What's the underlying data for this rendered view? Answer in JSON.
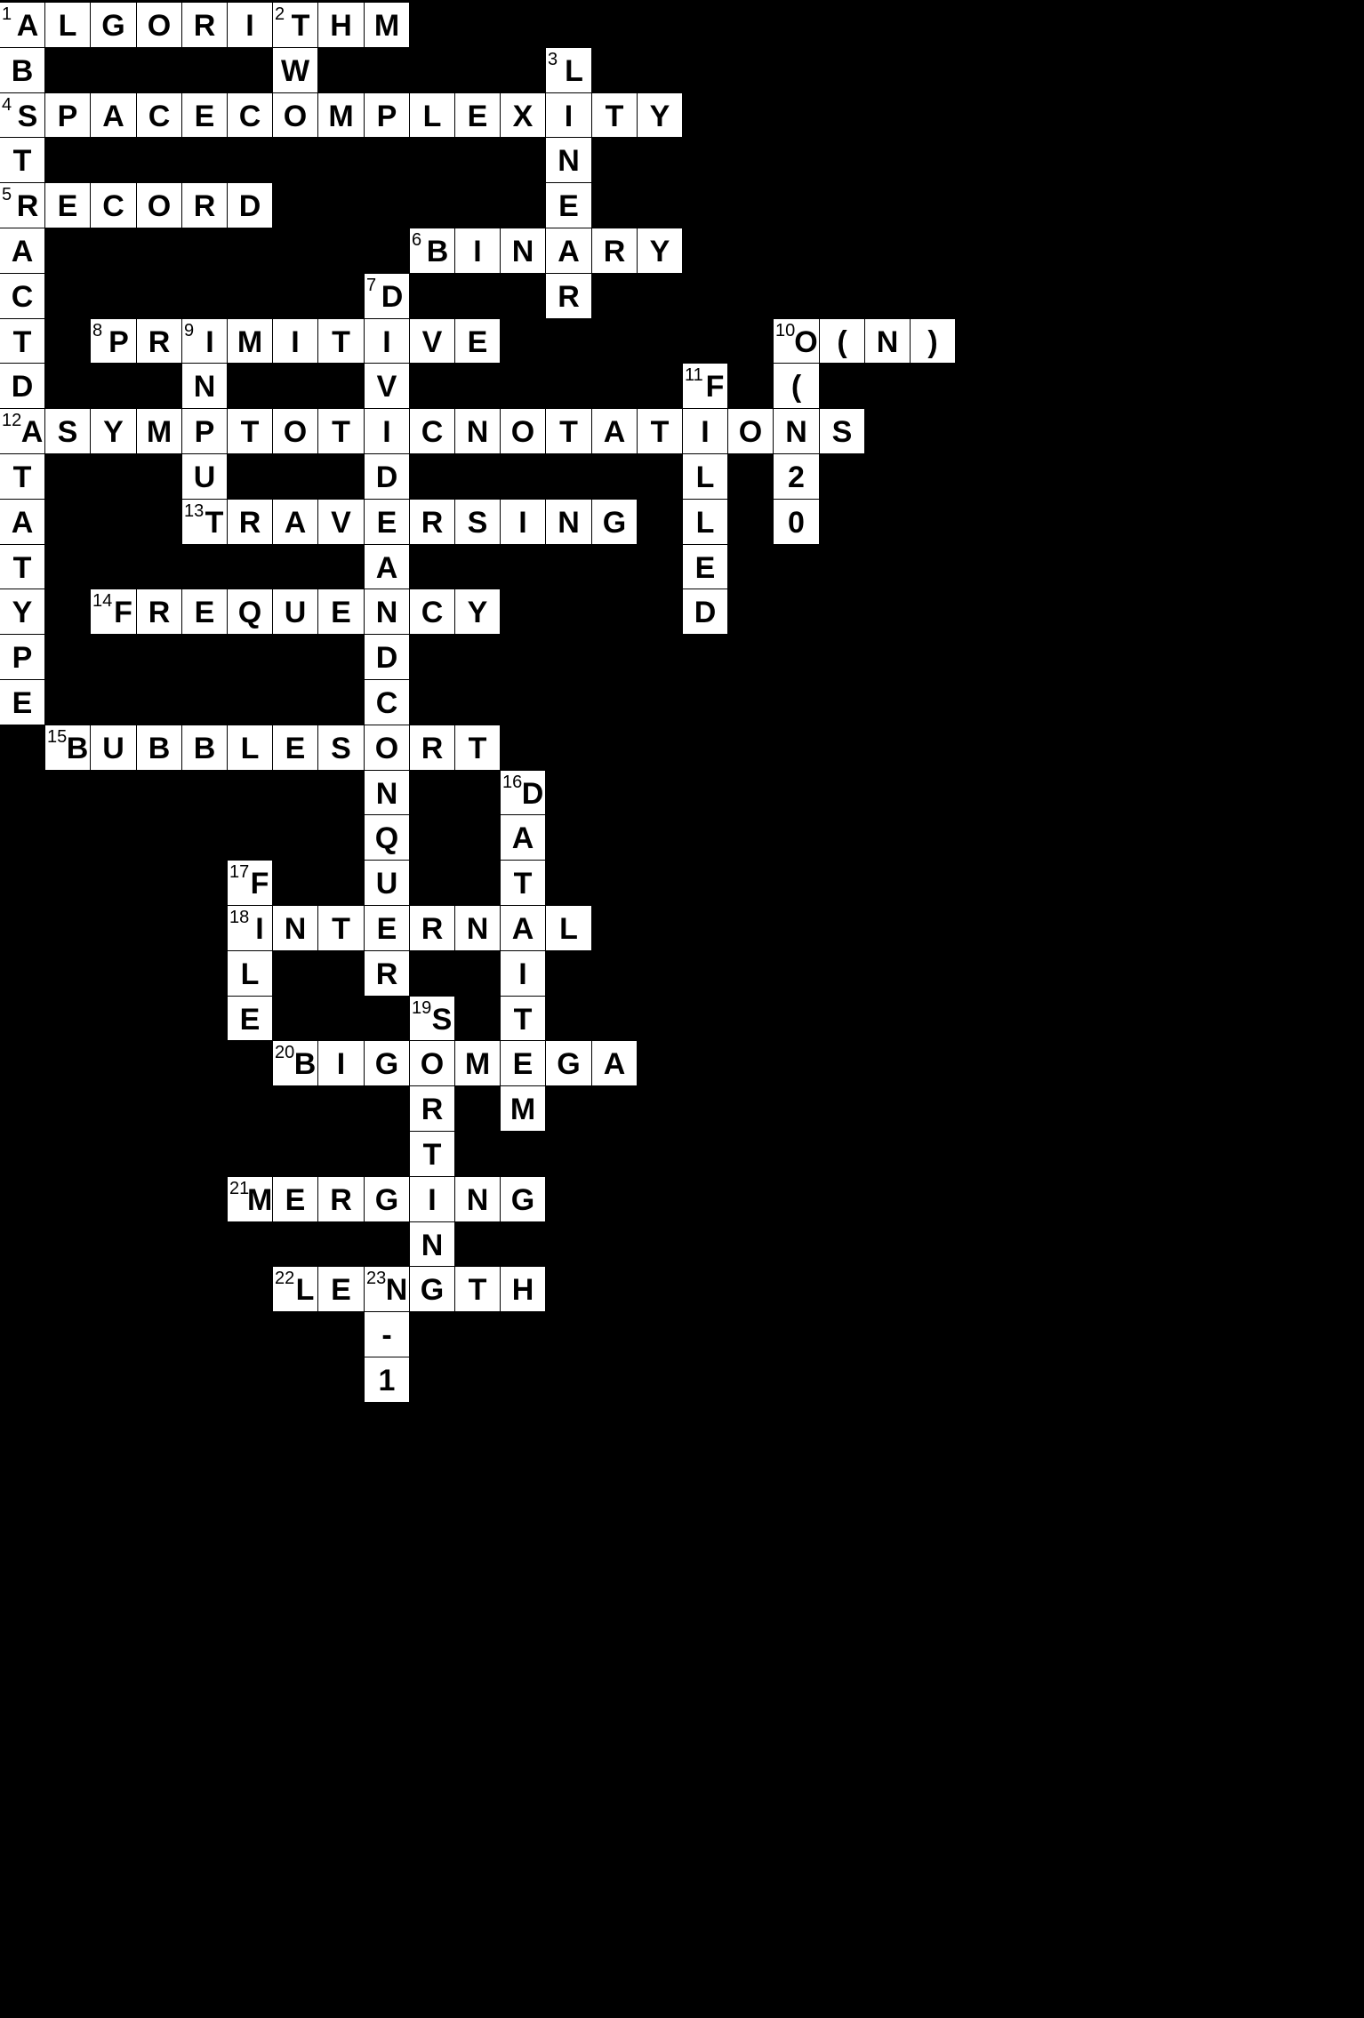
{
  "puzzle": {
    "cell_color": "#ffffff",
    "block_color": "#000000",
    "text_color": "#000000",
    "entries": [
      {
        "number": "1",
        "direction": "across",
        "row": 0,
        "col": 0,
        "answer": "ALGORITHM"
      },
      {
        "number": "1",
        "direction": "down",
        "row": 0,
        "col": 0,
        "answer": "ABSTRACTDATATYPE"
      },
      {
        "number": "2",
        "direction": "down",
        "row": 0,
        "col": 6,
        "answer": "TW"
      },
      {
        "number": "3",
        "direction": "down",
        "row": 1,
        "col": 12,
        "answer": "LINEAR"
      },
      {
        "number": "4",
        "direction": "across",
        "row": 2,
        "col": 0,
        "answer": "SPACECOMPLEXITY"
      },
      {
        "number": "5",
        "direction": "across",
        "row": 4,
        "col": 0,
        "answer": "RECORD"
      },
      {
        "number": "6",
        "direction": "across",
        "row": 5,
        "col": 9,
        "answer": "BINARY"
      },
      {
        "number": "7",
        "direction": "down",
        "row": 6,
        "col": 8,
        "answer": "DIVIDEANDCONQUER"
      },
      {
        "number": "8",
        "direction": "across",
        "row": 7,
        "col": 2,
        "answer": "PRIMITIVE"
      },
      {
        "number": "9",
        "direction": "down",
        "row": 7,
        "col": 4,
        "answer": "INPUT"
      },
      {
        "number": "10",
        "direction": "across",
        "row": 7,
        "col": 17,
        "answer": "O(N)"
      },
      {
        "number": "10",
        "direction": "down",
        "row": 7,
        "col": 17,
        "answer": "O(N20"
      },
      {
        "number": "11",
        "direction": "down",
        "row": 8,
        "col": 15,
        "answer": "FILLED"
      },
      {
        "number": "12",
        "direction": "across",
        "row": 9,
        "col": 0,
        "answer": "ASYMPTOTICNOTATIONS"
      },
      {
        "number": "13",
        "direction": "across",
        "row": 11,
        "col": 4,
        "answer": "TRAVERSING"
      },
      {
        "number": "14",
        "direction": "across",
        "row": 13,
        "col": 2,
        "answer": "FREQUENCY"
      },
      {
        "number": "15",
        "direction": "across",
        "row": 16,
        "col": 1,
        "answer": "BUBBLESORT"
      },
      {
        "number": "16",
        "direction": "down",
        "row": 17,
        "col": 11,
        "answer": "DATAITEM"
      },
      {
        "number": "17",
        "direction": "down",
        "row": 19,
        "col": 5,
        "answer": "FILE"
      },
      {
        "number": "18",
        "direction": "across",
        "row": 20,
        "col": 5,
        "answer": "INTERNAL"
      },
      {
        "number": "19",
        "direction": "down",
        "row": 22,
        "col": 9,
        "answer": "SORTING"
      },
      {
        "number": "20",
        "direction": "across",
        "row": 23,
        "col": 6,
        "answer": "BIGOMEGA"
      },
      {
        "number": "21",
        "direction": "across",
        "row": 26,
        "col": 5,
        "answer": "MERGING"
      },
      {
        "number": "22",
        "direction": "across",
        "row": 28,
        "col": 6,
        "answer": "LENGTH"
      },
      {
        "number": "23",
        "direction": "down",
        "row": 28,
        "col": 8,
        "answer": "N-1"
      }
    ]
  }
}
